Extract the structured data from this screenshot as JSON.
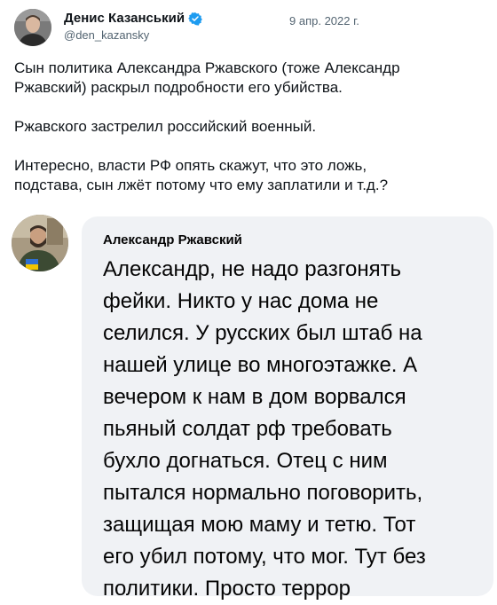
{
  "tweet": {
    "author_name": "Денис Казанський",
    "handle": "@den_kazansky",
    "date": "9 апр. 2022 г.",
    "paragraphs": [
      [
        "Сын политика Александра Ржавского (тоже Александр",
        "Ржавский) раскрыл подробности его убийства."
      ],
      [
        "Ржавского застрелил российский военный."
      ],
      [
        "Интересно, власти РФ опять скажут, что это ложь,",
        "подстава, сын лжёт потому что ему заплатили и т.д.?"
      ]
    ]
  },
  "quote": {
    "author_name": "Александр Ржавский",
    "lines": [
      "Александр, не надо разгонять",
      "фейки. Никто у нас дома не",
      "селился. У русских был штаб на",
      "нашей улице во многоэтажке. А",
      "вечером к нам в дом ворвался",
      "пьяный солдат рф требовать",
      "бухло догнаться. Отец с ним",
      "пытался нормально поговорить,",
      "защищая мою маму и тетю. Тот",
      "его убил потому, что мог. Тут без",
      "политики. Просто террор"
    ]
  },
  "icons": {
    "verified": "verified-badge-icon"
  },
  "colors": {
    "verified_blue": "#1d9bf0",
    "handle_gray": "#536471",
    "bubble_bg": "#f0f2f5",
    "text": "#0f1419"
  }
}
